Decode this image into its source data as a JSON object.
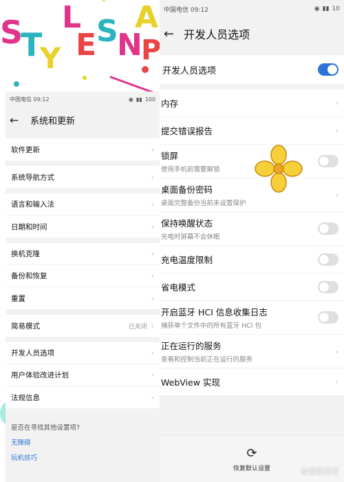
{
  "collage": {
    "letters": "STYLESNAP"
  },
  "left_phone": {
    "status_left": "中国电信 09:12",
    "status_right": "100",
    "title": "系统和更新",
    "groups": [
      [
        {
          "label": "软件更新"
        }
      ],
      [
        {
          "label": "系统导航方式"
        }
      ],
      [
        {
          "label": "语言和输入法"
        },
        {
          "label": "日期和时间"
        }
      ],
      [
        {
          "label": "换机克隆"
        },
        {
          "label": "备份和恢复"
        },
        {
          "label": "重置"
        }
      ],
      [
        {
          "label": "简易模式",
          "value": "已关闭"
        }
      ],
      [
        {
          "label": "开发人员选项"
        },
        {
          "label": "用户体验改进计划"
        },
        {
          "label": "法规信息"
        }
      ]
    ],
    "hint_title": "是否在寻找其他设置项?",
    "hint_links": [
      "无障碍",
      "玩机技巧"
    ]
  },
  "right_phone": {
    "status_left": "中国电信 09:12",
    "status_right": "10",
    "title": "开发人员选项",
    "top_toggle_label": "开发人员选项",
    "top_toggle_on": true,
    "rows": [
      {
        "title": "内存",
        "subtitle": "",
        "control": "chevron"
      },
      {
        "title": "提交错误报告",
        "subtitle": "",
        "control": "chevron"
      },
      {
        "title": "锁屏",
        "subtitle": "使用手机前需要解锁",
        "control": "toggle"
      },
      {
        "title": "桌面备份密码",
        "subtitle": "桌面完整备份当前未设置保护",
        "control": "chevron"
      },
      {
        "title": "保持唤醒状态",
        "subtitle": "充电时屏幕不会休眠",
        "control": "toggle"
      },
      {
        "title": "充电温度限制",
        "subtitle": "",
        "control": "toggle"
      },
      {
        "title": "省电模式",
        "subtitle": "",
        "control": "toggle"
      },
      {
        "title": "开启蓝牙 HCI 信息收集日志",
        "subtitle": "捕获单个文件中的所有蓝牙 HCI 包",
        "control": "toggle"
      },
      {
        "title": "正在运行的服务",
        "subtitle": "查看和控制当前正在运行的服务",
        "control": "chevron"
      },
      {
        "title": "WebView 实现",
        "subtitle": "",
        "control": "chevron"
      }
    ],
    "reset_label": "恢复默认设置"
  },
  "watermark": "@番茄日记",
  "icons": {
    "back": "back-arrow-icon",
    "chevron": "chevron-right-icon",
    "reset": "refresh-icon",
    "flower": "flower-sticker-icon"
  }
}
